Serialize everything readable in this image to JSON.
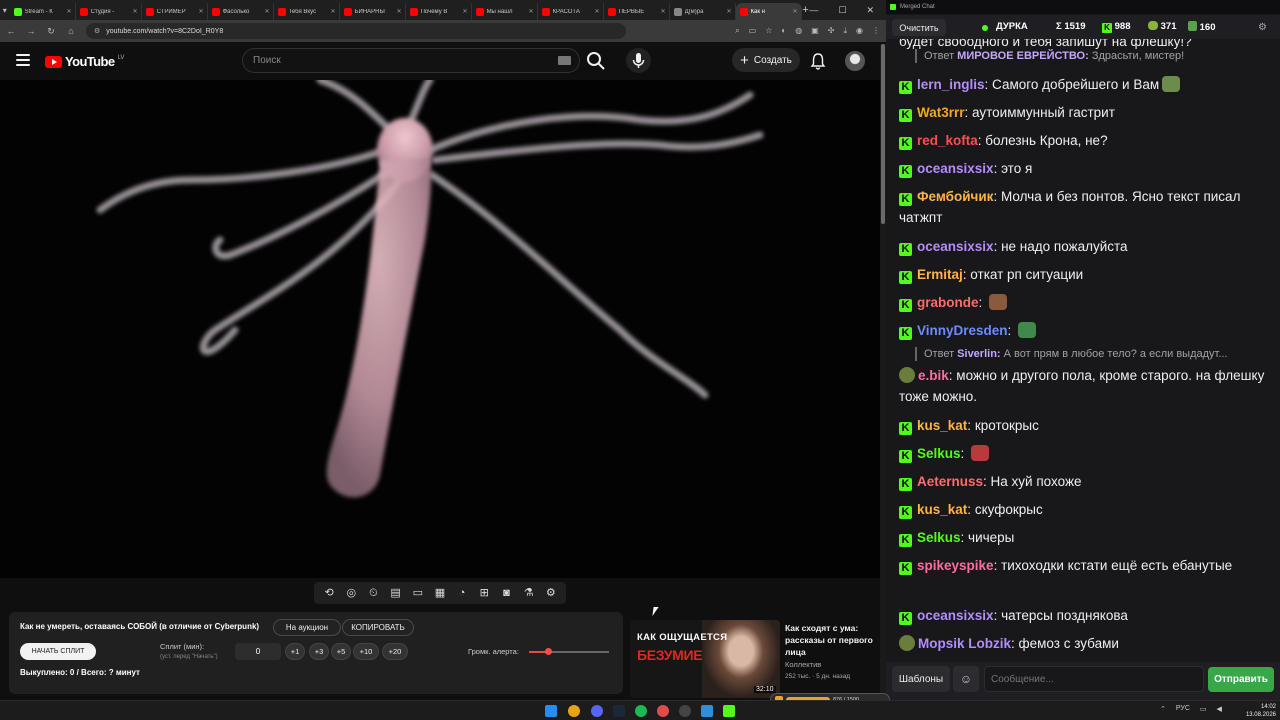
{
  "browser": {
    "tabs": [
      {
        "label": "Stream - К",
        "color": "#53fc18"
      },
      {
        "label": "Студия -",
        "color": "#ff0000"
      },
      {
        "label": "СТРИМЕР",
        "color": "#ff0000"
      },
      {
        "label": "Фасолько",
        "color": "#ff0000"
      },
      {
        "label": "Тебя Вкус",
        "color": "#ff0000"
      },
      {
        "label": "БИНАРНЫ",
        "color": "#ff0000"
      },
      {
        "label": "Почему В",
        "color": "#ff0000"
      },
      {
        "label": "Мы нашл",
        "color": "#ff0000"
      },
      {
        "label": "КРАСОТА",
        "color": "#ff0000"
      },
      {
        "label": "ПЕРВЫЕ",
        "color": "#ff0000"
      },
      {
        "label": "Д(м)ра",
        "color": "#888888"
      },
      {
        "label": "Как н",
        "color": "#ff0000"
      }
    ],
    "url": "youtube.com/watch?v=8C2DoI_R0Y8"
  },
  "youtube": {
    "logo_text": "YouTube",
    "country_code": "LV",
    "search_placeholder": "Поиск",
    "create_label": "Создать"
  },
  "panel": {
    "title": "Как не умереть, оставаясь СОБОЙ (в отличие от Cyberpunk)",
    "auction_label": "На аукцион",
    "copy_label": "КОПИРОВАТЬ",
    "start_label": "НАЧАТЬ СПЛИТ",
    "split_label": "Сплит (мин):",
    "split_hint": "(уст. перед \"Начать\")",
    "split_value": "0",
    "steps": [
      "+1",
      "+3",
      "+5",
      "+10",
      "+20"
    ],
    "stats": "Выкуплено: 0 / Всего: ? минут",
    "volume_label": "Громк. алерта:",
    "volume_level": 0.24
  },
  "recommended": {
    "thumb_line1": "КАК ОЩУЩАЕТСЯ",
    "thumb_line2": "БЕЗУМИЕ",
    "duration": "32:10",
    "title": "Как сходят с ума: рассказы от первого лица",
    "channel": "Коллектив",
    "meta": "252 тыс. · 5 дн. назад"
  },
  "chat": {
    "window_title": "Merged Chat",
    "clear_label": "Очистить",
    "stream_name": "ДУРКА",
    "sigma": "Σ 1519",
    "kick_count": "988",
    "count_a": "371",
    "count_b": "160",
    "partial_line": "будет свободного и тебя запишут на флешку!?",
    "messages": [
      {
        "kind": "reply",
        "prefix": "Ответ",
        "reply_user": "МИРОВОЕ ЕВРЕЙСТВО:",
        "text": "Здрасьти, мистер!"
      },
      {
        "kind": "msg",
        "user": "lern_inglis",
        "color": "#b48cff",
        "text": "Самого добрейшего и Вам"
      },
      {
        "kind": "msg",
        "user": "Wat3rrr",
        "color": "#f5a623",
        "text": "аутоиммунный гастрит"
      },
      {
        "kind": "msg",
        "user": "red_kofta",
        "color": "#ff4d4d",
        "text": "болезнь Крона, не?"
      },
      {
        "kind": "msg",
        "user": "oceansixsix",
        "color": "#b48cff",
        "text": "это я"
      },
      {
        "kind": "msg",
        "user": "Фембойчик",
        "color": "#ffb347",
        "text": "Молча и без понтов. Ясно текст писал чатжпт"
      },
      {
        "kind": "msg",
        "user": "oceansixsix",
        "color": "#b48cff",
        "text": "не надо пожалуйста"
      },
      {
        "kind": "msg",
        "user": "Ermitaj",
        "color": "#ffb347",
        "text": "откат рп ситуации"
      },
      {
        "kind": "msg",
        "user": "grabonde",
        "color": "#ff6b6b",
        "text": ""
      },
      {
        "kind": "msg",
        "user": "VinnyDresden",
        "color": "#6b8cff",
        "text": ""
      },
      {
        "kind": "reply",
        "prefix": "Ответ",
        "reply_user": "Siverlin:",
        "text": "А вот прям в любое тело? а если выдадут..."
      },
      {
        "kind": "msg",
        "user": "e.bik",
        "color": "#ff6b9d",
        "text": "можно и другого пола, кроме старого. на флешку тоже можно."
      },
      {
        "kind": "msg",
        "user": "kus_kat",
        "color": "#ffb347",
        "text": "кротокрыс"
      },
      {
        "kind": "msg",
        "user": "Selkus",
        "color": "#53fc18",
        "text": ""
      },
      {
        "kind": "msg",
        "user": "Aeternuss",
        "color": "#ff6b6b",
        "text": "На хуй похоже"
      },
      {
        "kind": "msg",
        "user": "kus_kat",
        "color": "#ffb347",
        "text": "скуфокрыс"
      },
      {
        "kind": "msg",
        "user": "Selkus",
        "color": "#53fc18",
        "text": "чичеры"
      },
      {
        "kind": "msg",
        "user": "spikeyspike",
        "color": "#ff6b9d",
        "text": "тихоходки кстати ещё есть ебанутые"
      },
      {
        "kind": "msg",
        "user": "oceansixsix",
        "color": "#b48cff",
        "text": "чатерсы позднякова"
      },
      {
        "kind": "msg",
        "user": "Mopsik Lobzik",
        "color": "#b48cff",
        "text": "фемоз  с зубами"
      }
    ],
    "templates_label": "Шаблоны",
    "input_placeholder": "Сообщение...",
    "send_label": "Отправить"
  },
  "taskbar": {
    "lang": "РУС",
    "time": "14:02",
    "date": "13.08.2026",
    "notif_text": "876 / 1500"
  }
}
